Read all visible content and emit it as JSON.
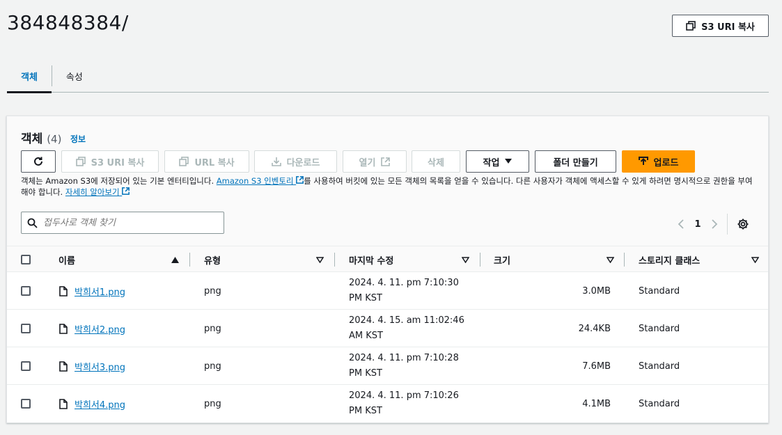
{
  "header": {
    "title": "384848384/",
    "copy_uri_label": "S3 URI 복사"
  },
  "tabs": [
    {
      "label": "객체",
      "active": true
    },
    {
      "label": "속성",
      "active": false
    }
  ],
  "objects": {
    "title": "객체",
    "count": "(4)",
    "info_label": "정보",
    "actions": {
      "refresh": "refresh",
      "copy_s3_uri": "S3 URI 복사",
      "copy_url": "URL 복사",
      "download": "다운로드",
      "open": "열기",
      "delete": "삭제",
      "actions": "작업",
      "create_folder": "폴더 만들기",
      "upload": "업로드"
    },
    "description": {
      "part1": "객체는 Amazon S3에 저장되어 있는 기본 엔터티입니다. ",
      "inventory_link": "Amazon S3 인벤토리",
      "part2": "를 사용하여 버킷에 있는 모든 객체의 목록을 얻을 수 있습니다. 다른 사용자가 객체에 액세스할 수 있게 하려면 명시적으로 권한을 부여해야 합니다. ",
      "learn_more_link": "자세히 알아보기"
    },
    "search": {
      "placeholder": "접두사로 객체 찾기",
      "value": ""
    },
    "pagination": {
      "current_page": "1"
    },
    "columns": {
      "name": "이름",
      "type": "유형",
      "last_modified": "마지막 수정",
      "size": "크기",
      "storage_class": "스토리지 클래스"
    },
    "rows": [
      {
        "name": "박희서1.png",
        "type": "png",
        "date_line1": "2024. 4. 11. pm 7:10:30",
        "date_line2": "PM KST",
        "size": "3.0MB",
        "storage_class": "Standard"
      },
      {
        "name": "박희서2.png",
        "type": "png",
        "date_line1": "2024. 4. 15. am 11:02:46",
        "date_line2": "AM KST",
        "size": "24.4KB",
        "storage_class": "Standard"
      },
      {
        "name": "박희서3.png",
        "type": "png",
        "date_line1": "2024. 4. 11. pm 7:10:28",
        "date_line2": "PM KST",
        "size": "7.6MB",
        "storage_class": "Standard"
      },
      {
        "name": "박희서4.png",
        "type": "png",
        "date_line1": "2024. 4. 11. pm 7:10:26",
        "date_line2": "PM KST",
        "size": "4.1MB",
        "storage_class": "Standard"
      }
    ]
  },
  "colors": {
    "link": "#0073bb",
    "primary": "#ff9900",
    "border": "#545b64"
  }
}
